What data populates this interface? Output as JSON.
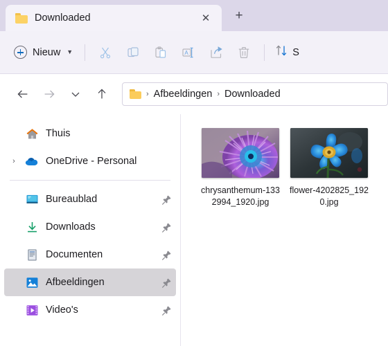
{
  "window": {
    "tab": {
      "title": "Downloaded",
      "icon": "folder-icon",
      "close_label": "✕"
    },
    "new_tab_label": "+"
  },
  "toolbar": {
    "new_button": {
      "label": "Nieuw",
      "icon": "plus-circle-icon",
      "chevron": "⌄"
    },
    "items": [
      {
        "name": "cut",
        "icon": "scissors-icon",
        "enabled": false
      },
      {
        "name": "copy",
        "icon": "copy-icon",
        "enabled": false
      },
      {
        "name": "paste",
        "icon": "clipboard-paste-icon",
        "enabled": false
      },
      {
        "name": "rename",
        "icon": "rename-icon",
        "enabled": false
      },
      {
        "name": "share",
        "icon": "share-icon",
        "enabled": false
      },
      {
        "name": "delete",
        "icon": "trash-icon",
        "enabled": false
      }
    ],
    "sort": {
      "label": "S",
      "icon": "sort-arrows-icon"
    }
  },
  "navigation": {
    "back": {
      "label": "←",
      "enabled": true
    },
    "forward": {
      "label": "→",
      "enabled": false
    },
    "recent": {
      "label": "⌄",
      "enabled": true
    },
    "up": {
      "label": "↑",
      "enabled": true
    },
    "breadcrumb": {
      "icon": "folder-icon",
      "separator": "›",
      "parts": [
        "Afbeeldingen",
        "Downloaded"
      ]
    }
  },
  "sidebar": {
    "top_items": [
      {
        "label": "Thuis",
        "icon": "home-icon",
        "expandable": false,
        "pinned": false,
        "selected": false
      },
      {
        "label": "OneDrive - Personal",
        "icon": "cloud-icon",
        "expandable": true,
        "pinned": false,
        "selected": false
      }
    ],
    "quick_access": [
      {
        "label": "Bureaublad",
        "icon": "desktop-icon",
        "pinned": true,
        "selected": false
      },
      {
        "label": "Downloads",
        "icon": "download-icon",
        "pinned": true,
        "selected": false
      },
      {
        "label": "Documenten",
        "icon": "document-icon",
        "pinned": true,
        "selected": false
      },
      {
        "label": "Afbeeldingen",
        "icon": "pictures-icon",
        "pinned": true,
        "selected": true
      },
      {
        "label": "Video's",
        "icon": "video-icon",
        "pinned": true,
        "selected": false
      }
    ],
    "expander_glyph": "›",
    "pin_glyph": "pin-icon"
  },
  "files": [
    {
      "name": "chrysanthemum-1332994_1920.jpg",
      "thumbnail": "chrysanthemum-photo",
      "selected": false
    },
    {
      "name": "flower-4202825_1920.jpg",
      "thumbnail": "blue-poppy-photo",
      "selected": false
    }
  ],
  "colors": {
    "titlebar": "#dcd7e9",
    "tab_active": "#f4f2f9",
    "commandbar": "#f3f1f8",
    "accent_blue": "#0f6cbd",
    "folder_yellow": "#fbcc5c",
    "selection_grey": "#d6d4d8"
  }
}
